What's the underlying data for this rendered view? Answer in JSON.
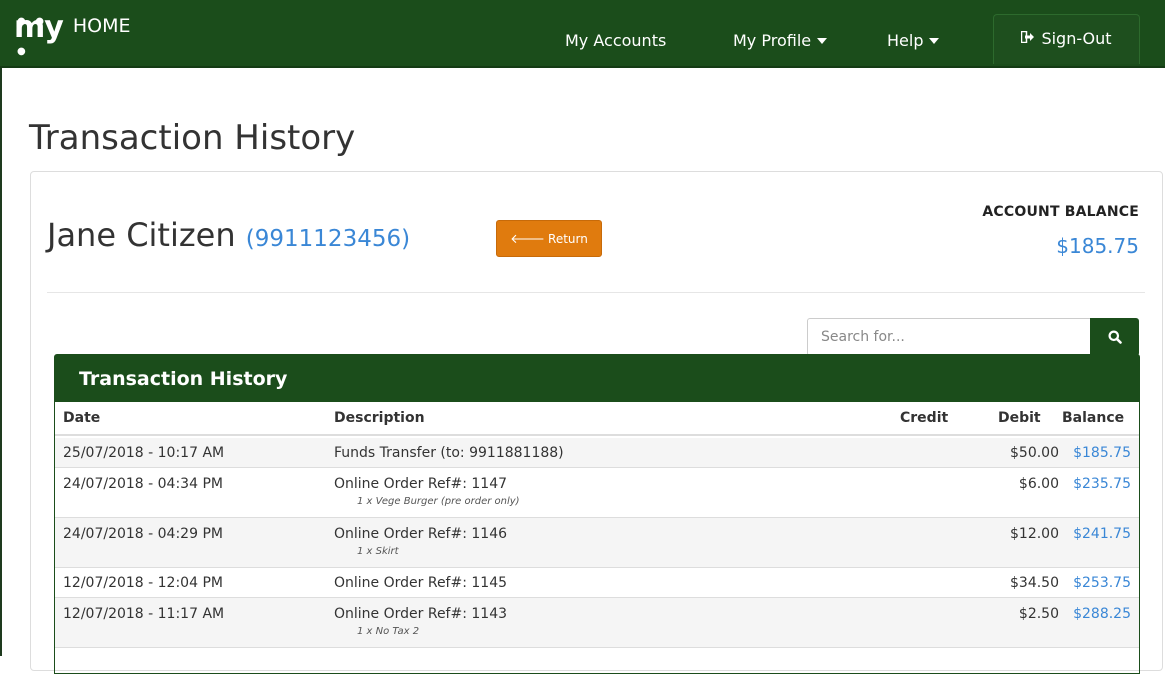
{
  "navbar": {
    "brand_logo": "my",
    "brand_text": "HOME",
    "items": [
      {
        "label": "My Accounts",
        "dropdown": false
      },
      {
        "label": "My Profile",
        "dropdown": true
      },
      {
        "label": "Help",
        "dropdown": true
      }
    ],
    "signout_label": "Sign-Out",
    "signout_icon": "sign-out-icon"
  },
  "page": {
    "title": "Transaction History"
  },
  "account": {
    "name": "Jane Citizen",
    "number": "(9911123456)",
    "return_label": "Return",
    "balance_label": "ACCOUNT BALANCE",
    "balance_value": "$185.75"
  },
  "search": {
    "placeholder": "Search for...",
    "value": "",
    "icon": "search-icon"
  },
  "table": {
    "heading": "Transaction History",
    "columns": [
      "Date",
      "Description",
      "Credit",
      "Debit",
      "Balance"
    ],
    "rows": [
      {
        "date": "25/07/2018 - 10:17 AM",
        "description": "Funds Transfer (to: 9911881188)",
        "sub": "",
        "credit": "",
        "debit": "$50.00",
        "balance": "$185.75"
      },
      {
        "date": "24/07/2018 - 04:34 PM",
        "description": "Online Order Ref#: 1147",
        "sub": "1 x Vege Burger (pre order only)",
        "credit": "",
        "debit": "$6.00",
        "balance": "$235.75"
      },
      {
        "date": "24/07/2018 - 04:29 PM",
        "description": "Online Order Ref#: 1146",
        "sub": "1 x Skirt",
        "credit": "",
        "debit": "$12.00",
        "balance": "$241.75"
      },
      {
        "date": "12/07/2018 - 12:04 PM",
        "description": "Online Order Ref#: 1145",
        "sub": "",
        "credit": "",
        "debit": "$34.50",
        "balance": "$253.75"
      },
      {
        "date": "12/07/2018 - 11:17 AM",
        "description": "Online Order Ref#: 1143",
        "sub": "1 x No Tax 2",
        "credit": "",
        "debit": "$2.50",
        "balance": "$288.25"
      }
    ]
  },
  "colors": {
    "navbar": "#1b4d1b",
    "accent_blue": "#3a87d6",
    "return_button": "#e07b0e"
  }
}
